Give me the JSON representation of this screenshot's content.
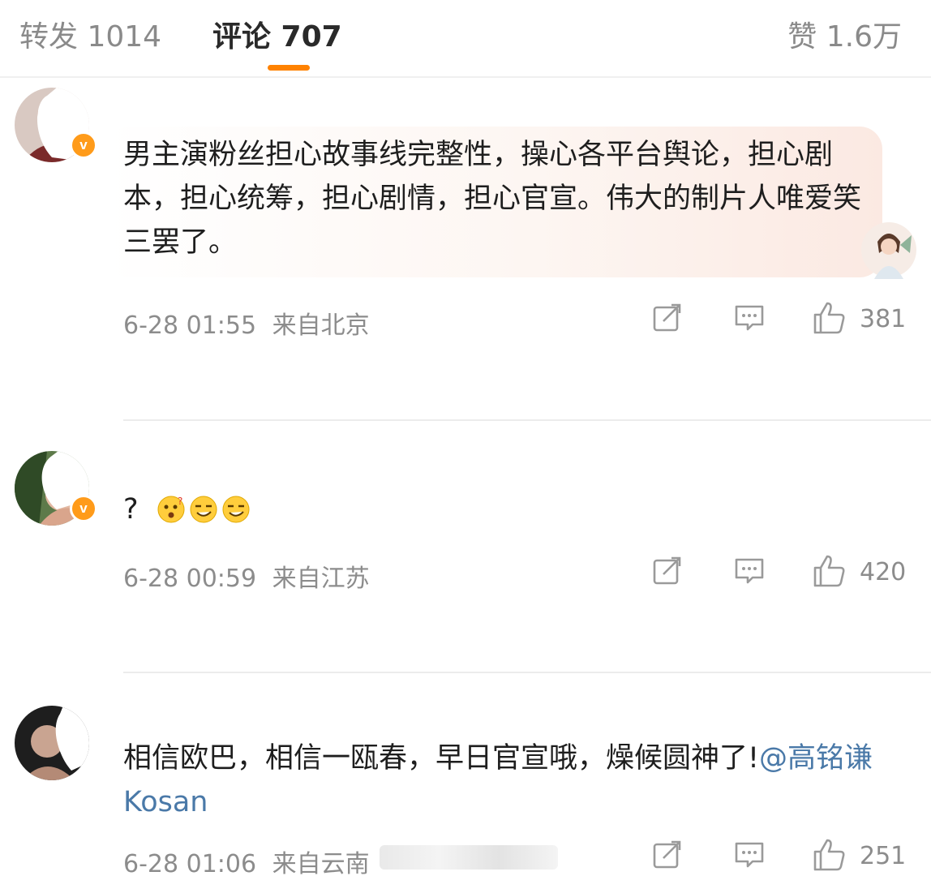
{
  "tabs": {
    "repost": "转发 1014",
    "comments": "评论 707",
    "likes": "赞 1.6万"
  },
  "colors": {
    "accent": "#ff8200",
    "mention": "#4a79a8",
    "verified_badge": "#ff9b1a",
    "meta_text": "#8c8c8c"
  },
  "comments": [
    {
      "text": "男主演粉丝担心故事线完整性，操心各平台舆论，担心剧本，担心统筹，担心剧情，担心官宣。伟大的制片人唯爱笑三罢了。",
      "time": "6-28 01:55",
      "location": "来自北京",
      "likes": "381",
      "verified": true,
      "badge": "v"
    },
    {
      "text": "?",
      "emojis": [
        "surprised-emoji",
        "smirk-emoji",
        "smirk-emoji"
      ],
      "time": "6-28 00:59",
      "location": "来自江苏",
      "likes": "420",
      "verified": true,
      "badge": "v"
    },
    {
      "text": "相信欧巴，相信一瓯春，早日官宣哦，燥候圆神了!",
      "mention": "@高铭谦Kosan",
      "time": "6-28 01:06",
      "location": "来自云南",
      "likes": "251",
      "verified": false
    }
  ],
  "icons": {
    "share": "share-icon",
    "reply": "comment-icon",
    "like": "thumbs-up-icon"
  }
}
